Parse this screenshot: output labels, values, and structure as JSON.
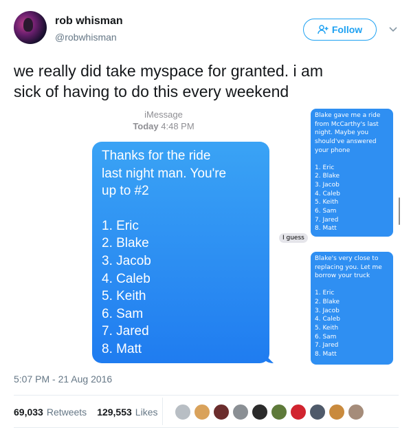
{
  "user": {
    "name": "rob whisman",
    "handle": "@robwhisman"
  },
  "actions": {
    "follow_label": "Follow"
  },
  "tweet": {
    "line1": "we really did take myspace for granted. i am",
    "line2": "sick of having to do this every weekend",
    "timestamp": "5:07 PM - 21 Aug 2016"
  },
  "stats": {
    "retweets_count": "69,033",
    "retweets_label": "Retweets",
    "likes_count": "129,553",
    "likes_label": "Likes"
  },
  "image_left": {
    "header_title": "iMessage",
    "header_day": "Today",
    "header_time": "4:48 PM",
    "message_intro": [
      "Thanks for the ride",
      "last night man. You're",
      "up to #2"
    ],
    "list": [
      "1. Eric",
      "2. Blake",
      "3. Jacob",
      "4. Caleb",
      "5. Keith",
      "6. Sam",
      "7. Jared",
      "8. Matt"
    ]
  },
  "image_right": {
    "bubble1_text": [
      "Blake gave me a ride",
      "from McCarthy's last",
      "night. Maybe you",
      "should've answered",
      "your phone"
    ],
    "bubble1_list": [
      "1. Eric",
      "2. Blake",
      "3. Jacob",
      "4. Caleb",
      "5. Keith",
      "6. Sam",
      "7. Jared",
      "8. Matt"
    ],
    "reply": "I guess",
    "bubble2_text": [
      "Blake's very close to",
      "replacing you. Let me",
      "borrow your truck"
    ],
    "bubble2_list": [
      "1. Eric",
      "2. Blake",
      "3. Jacob",
      "4. Caleb",
      "5. Keith",
      "6. Sam",
      "7. Jared",
      "8. Matt"
    ]
  },
  "colors": {
    "twitter_blue": "#1da1f2",
    "imessage_blue": "#2b8cf2",
    "muted_text": "#657786"
  },
  "liker_colors": [
    "#b8bec4",
    "#d9a25b",
    "#6b2d2d",
    "#8a8f94",
    "#2b2b2b",
    "#5e7a3a",
    "#d1242f",
    "#4f5a6a",
    "#c98a3d",
    "#a58c7a"
  ]
}
